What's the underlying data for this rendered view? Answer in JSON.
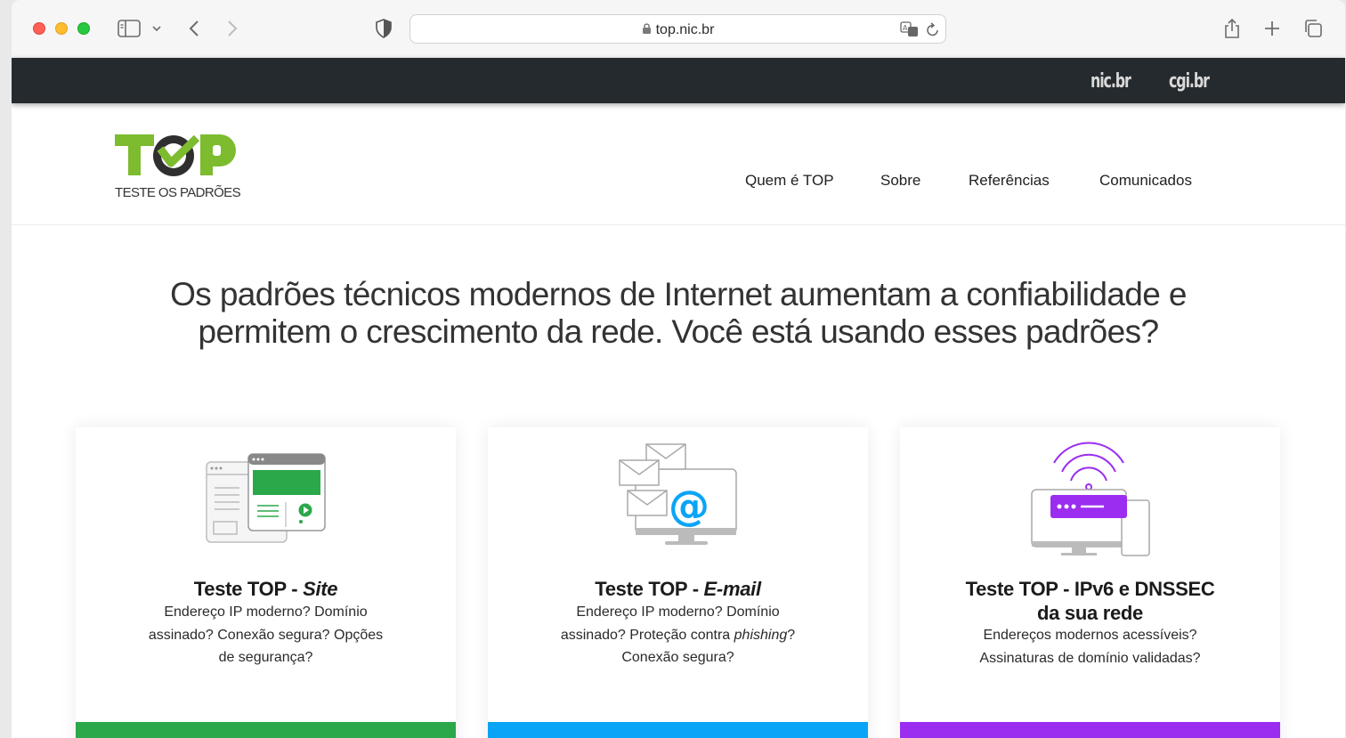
{
  "browser": {
    "url": "top.nic.br"
  },
  "topbar": {
    "brand_left": "nic.br",
    "brand_right": "cgi.br"
  },
  "logo": {
    "word": "TOP",
    "tagline": "TESTE OS PADRÕES"
  },
  "nav": [
    "Quem é TOP",
    "Sobre",
    "Referências",
    "Comunicados"
  ],
  "hero": {
    "line1": "Os padrões técnicos modernos de Internet aumentam a confiabilidade e",
    "line2": "permitem o crescimento da rede. Você está usando esses padrões?"
  },
  "cards": [
    {
      "title_prefix": "Teste TOP - ",
      "title_emph": "Site",
      "desc": [
        "Endereço IP moderno? Domínio",
        "assinado? Conexão segura? Opções",
        "de segurança?"
      ],
      "color": "#2ba84a"
    },
    {
      "title_prefix": "Teste TOP - ",
      "title_emph": "E-mail",
      "desc_line1": "Endereço IP moderno? Domínio",
      "desc_line2_pre": "assinado? Proteção contra ",
      "desc_line2_em": "phishing",
      "desc_line2_post": "?",
      "desc_line3": "Conexão segura?",
      "color": "#0aa4f6"
    },
    {
      "title_line1": "Teste TOP - IPv6 e DNSSEC",
      "title_line2": "da sua rede",
      "desc": [
        "Endereços modernos acessíveis?",
        "Assinaturas de domínio validadas?"
      ],
      "color": "#9b2df0"
    }
  ],
  "colors": {
    "green": "#2ba84a",
    "blue": "#0aa4f6",
    "purple": "#9b2df0",
    "darkbar": "#252a2e"
  }
}
